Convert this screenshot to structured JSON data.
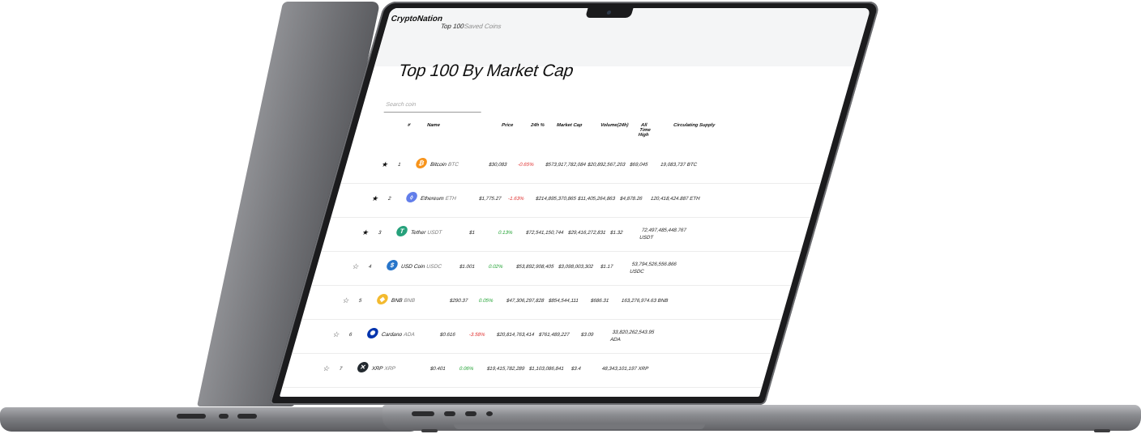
{
  "app": {
    "brand": "CryptoNation",
    "nav": [
      {
        "label": "Top 100"
      },
      {
        "label": "Saved Coins"
      }
    ]
  },
  "page": {
    "title": "Top 100 By Market Cap"
  },
  "search": {
    "placeholder": "Search coin"
  },
  "table": {
    "headers": [
      "#",
      "Name",
      "Price",
      "24h %",
      "Market Cap",
      "Volume(24h)",
      "All Time High",
      "Circulating Supply"
    ],
    "rows": [
      {
        "saved": true,
        "rank": "1",
        "name": "Bitcoin",
        "symbol": "BTC",
        "icon": "bitcoin-icon",
        "color": "#f7931a",
        "price": "$30,083",
        "change": "-0.65%",
        "change_dir": "neg",
        "market_cap": "$573,917,782,084",
        "volume": "$20,892,567,203",
        "ath": "$69,045",
        "supply": "19,083,737 BTC"
      },
      {
        "saved": true,
        "rank": "2",
        "name": "Ethereum",
        "symbol": "ETH",
        "icon": "ethereum-icon",
        "color": "#627eea",
        "price": "$1,775.27",
        "change": "-1.63%",
        "change_dir": "neg",
        "market_cap": "$214,895,370,865",
        "volume": "$11,405,264,863",
        "ath": "$4,878.26",
        "supply": "120,418,424.887 ETH"
      },
      {
        "saved": true,
        "rank": "3",
        "name": "Tether",
        "symbol": "USDT",
        "icon": "tether-icon",
        "color": "#26a17b",
        "price": "$1",
        "change": "0.13%",
        "change_dir": "pos",
        "market_cap": "$72,541,150,744",
        "volume": "$29,416,272,831",
        "ath": "$1.32",
        "supply": "72,497,485,448.767 USDT"
      },
      {
        "saved": false,
        "rank": "4",
        "name": "USD Coin",
        "symbol": "USDC",
        "icon": "usdc-icon",
        "color": "#2775ca",
        "price": "$1.001",
        "change": "0.02%",
        "change_dir": "pos",
        "market_cap": "$53,892,908,405",
        "volume": "$3,098,003,302",
        "ath": "$1.17",
        "supply": "53,794,526,556.866 USDC"
      },
      {
        "saved": false,
        "rank": "5",
        "name": "BNB",
        "symbol": "BNB",
        "icon": "bnb-icon",
        "color": "#f3ba2f",
        "price": "$290.37",
        "change": "0.05%",
        "change_dir": "pos",
        "market_cap": "$47,306,297,828",
        "volume": "$854,544,111",
        "ath": "$686.31",
        "supply": "163,276,974.63 BNB"
      },
      {
        "saved": false,
        "rank": "6",
        "name": "Cardano",
        "symbol": "ADA",
        "icon": "cardano-icon",
        "color": "#0033ad",
        "price": "$0.616",
        "change": "-3.58%",
        "change_dir": "neg",
        "market_cap": "$20,814,763,414",
        "volume": "$761,489,227",
        "ath": "$3.09",
        "supply": "33,820,262,543.95 ADA"
      },
      {
        "saved": false,
        "rank": "7",
        "name": "XRP",
        "symbol": "XRP",
        "icon": "xrp-icon",
        "color": "#23292f",
        "price": "$0.401",
        "change": "0.06%",
        "change_dir": "pos",
        "market_cap": "$19,415,782,289",
        "volume": "$1,103,086,841",
        "ath": "$3.4",
        "supply": "48,343,101,197 XRP"
      }
    ]
  }
}
